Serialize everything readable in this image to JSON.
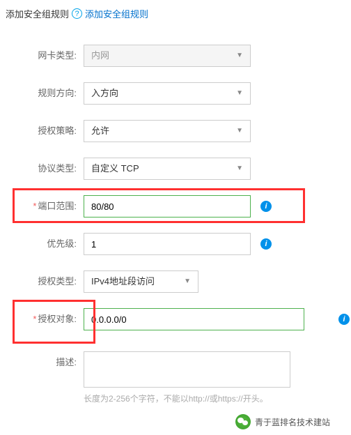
{
  "header": {
    "title": "添加安全组规则",
    "help_link": "添加安全组规则"
  },
  "form": {
    "nic_type": {
      "label": "网卡类型:",
      "value": "内网"
    },
    "direction": {
      "label": "规则方向:",
      "value": "入方向"
    },
    "policy": {
      "label": "授权策略:",
      "value": "允许"
    },
    "protocol": {
      "label": "协议类型:",
      "value": "自定义 TCP"
    },
    "port_range": {
      "label": "端口范围:",
      "value": "80/80"
    },
    "priority": {
      "label": "优先级:",
      "value": "1"
    },
    "auth_type": {
      "label": "授权类型:",
      "value": "IPv4地址段访问"
    },
    "auth_object": {
      "label": "授权对象:",
      "value": "0.0.0.0/0"
    },
    "description": {
      "label": "描述:",
      "value": "",
      "hint": "长度为2-256个字符，不能以http://或https://开头。"
    }
  },
  "footer": {
    "text": "青于蓝排名技术建站"
  }
}
